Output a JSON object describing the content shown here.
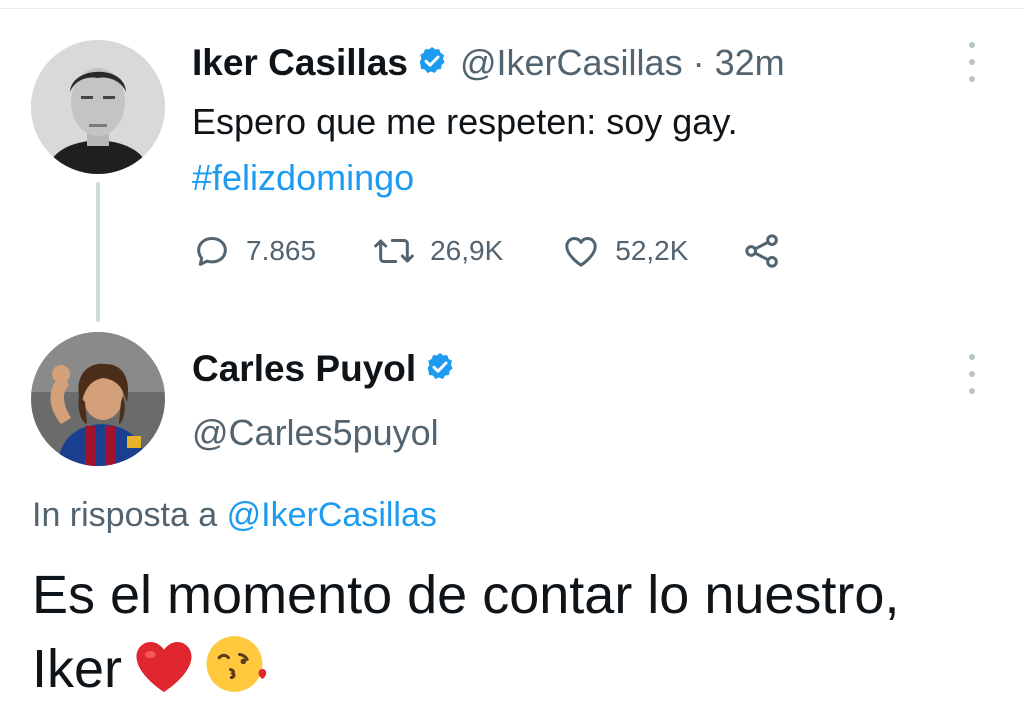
{
  "tweet1": {
    "display_name": "Iker Casillas",
    "handle": "@IkerCasillas",
    "separator": "·",
    "time": "32m",
    "text": "Espero que me respeten: soy gay.",
    "hashtag": "#felizdomingo",
    "actions": {
      "replies": "7.865",
      "retweets": "26,9K",
      "likes": "52,2K"
    }
  },
  "tweet2": {
    "display_name": "Carles Puyol",
    "handle": "@Carles5puyol",
    "reply_prefix": "In risposta a",
    "reply_mention": "@IkerCasillas",
    "text": "Es el momento de contar lo nuestro, Iker"
  },
  "icons": {
    "verified": "verified-badge-icon",
    "reply": "reply-bubble-icon",
    "retweet": "retweet-icon",
    "like": "heart-outline-icon",
    "share": "share-icon",
    "more": "more-vertical-icon",
    "heart_emoji": "red-heart-emoji",
    "kiss_emoji": "face-blowing-kiss-emoji"
  },
  "colors": {
    "accent": "#1d9bf0",
    "secondary_text": "#536471",
    "primary_text": "#0f1419"
  }
}
